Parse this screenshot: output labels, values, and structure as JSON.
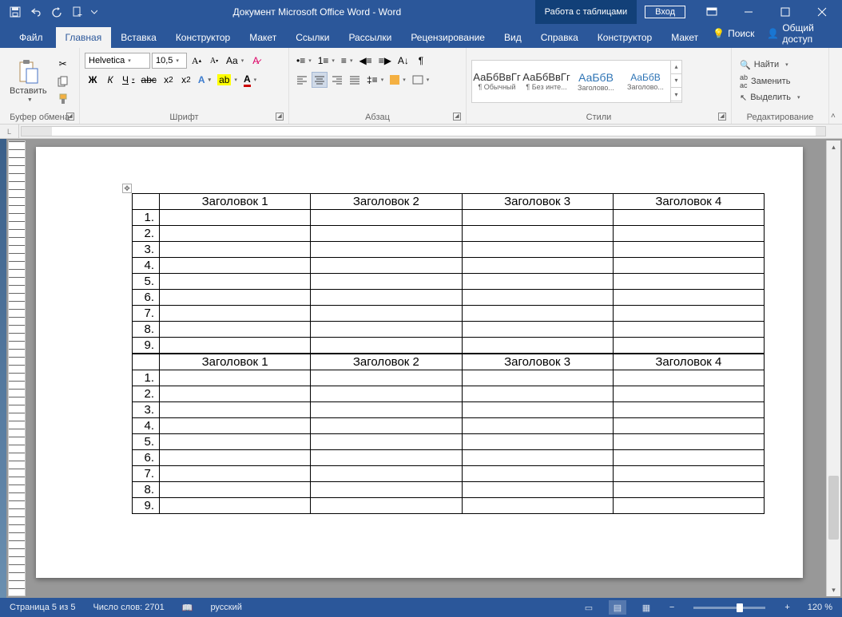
{
  "titlebar": {
    "doc_title": "Документ Microsoft Office Word  -  Word",
    "table_tools": "Работа с таблицами",
    "login": "Вход"
  },
  "tabs": {
    "file": "Файл",
    "home": "Главная",
    "insert": "Вставка",
    "design": "Конструктор",
    "layout": "Макет",
    "references": "Ссылки",
    "mailings": "Рассылки",
    "review": "Рецензирование",
    "view": "Вид",
    "help": "Справка",
    "tbl_design": "Конструктор",
    "tbl_layout": "Макет",
    "tellme": "Поиск",
    "share": "Общий доступ"
  },
  "ribbon": {
    "clipboard": {
      "paste": "Вставить",
      "group": "Буфер обмена"
    },
    "font": {
      "name": "Helvetica",
      "size": "10,5",
      "group": "Шрифт",
      "bold": "Ж",
      "italic": "К",
      "underline": "Ч"
    },
    "paragraph": {
      "group": "Абзац"
    },
    "styles": {
      "group": "Стили",
      "sample": "АаБбВвГг",
      "sample_short": "АаБбВ",
      "normal": "¶ Обычный",
      "nospace": "¶ Без инте...",
      "h1": "Заголово...",
      "h2": "Заголово..."
    },
    "editing": {
      "group": "Редактирование",
      "find": "Найти",
      "replace": "Заменить",
      "select": "Выделить"
    }
  },
  "document": {
    "table": {
      "headers": [
        "Заголовок 1",
        "Заголовок 2",
        "Заголовок 3",
        "Заголовок 4"
      ],
      "rows": [
        "1.",
        "2.",
        "3.",
        "4.",
        "5.",
        "6.",
        "7.",
        "8.",
        "9."
      ]
    }
  },
  "statusbar": {
    "page": "Страница 5 из 5",
    "words": "Число слов: 2701",
    "lang": "русский",
    "zoom": "120 %"
  }
}
